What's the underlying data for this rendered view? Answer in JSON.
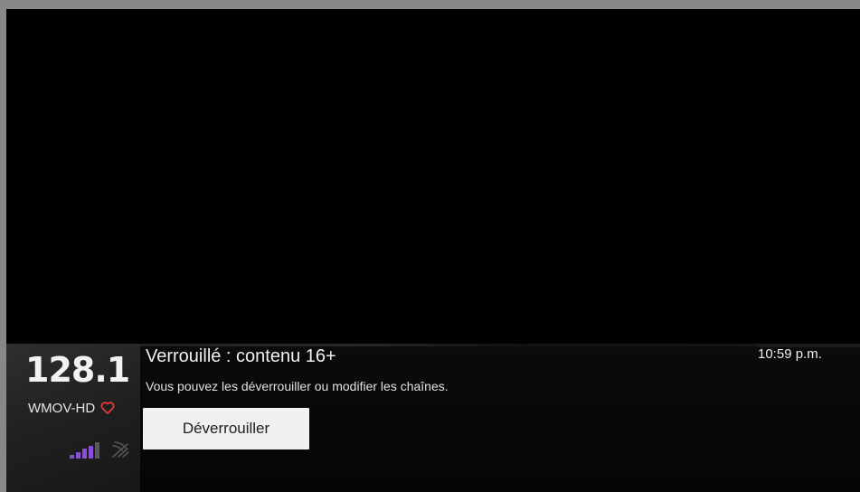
{
  "channel": {
    "number": "128.1",
    "name": "WMOV-HD",
    "favorite": true,
    "favorite_color": "#e23b3b",
    "signal_bars_lit": 4,
    "signal_bars_total": 5,
    "signal_color": "#8a4dd8",
    "signal_off_color": "#5a5a5a"
  },
  "lock": {
    "title": "Verrouillé : contenu 16+",
    "message": "Vous pouvez les déverrouiller ou modifier les chaînes."
  },
  "actions": {
    "unlock_label": "Déverrouiller"
  },
  "status": {
    "time": "10:59 p.m."
  },
  "icons": {
    "favorite": "heart-icon",
    "signal": "signal-strength-icon",
    "antenna": "antenna-icon"
  }
}
